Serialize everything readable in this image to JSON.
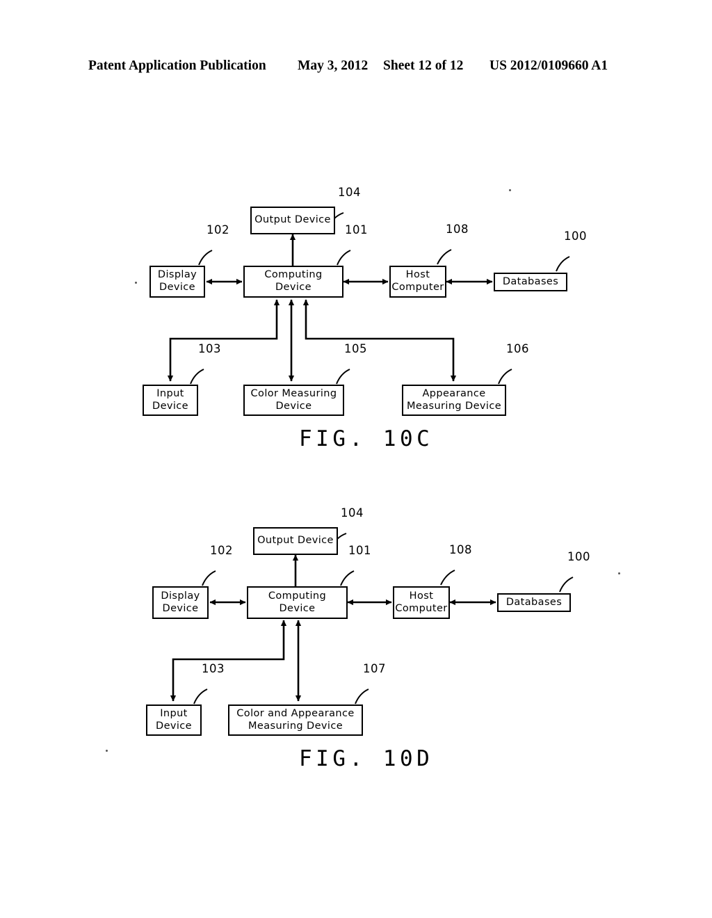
{
  "header": {
    "publication": "Patent Application Publication",
    "date": "May 3, 2012",
    "sheet": "Sheet 12 of 12",
    "document_number": "US 2012/0109660 A1"
  },
  "figures": [
    {
      "id": "fig-10c",
      "caption": "FIG. 10C",
      "nodes": [
        {
          "key": "output_device",
          "label": "Output Device",
          "ref": "104"
        },
        {
          "key": "display_device",
          "label": "Display\nDevice",
          "ref": "102"
        },
        {
          "key": "computing_device",
          "label": "Computing\nDevice",
          "ref": "101"
        },
        {
          "key": "host_computer",
          "label": "Host\nComputer",
          "ref": "108"
        },
        {
          "key": "databases",
          "label": "Databases",
          "ref": "100"
        },
        {
          "key": "input_device",
          "label": "Input\nDevice",
          "ref": "103"
        },
        {
          "key": "color_measuring",
          "label": "Color Measuring\nDevice",
          "ref": "105"
        },
        {
          "key": "appearance_measuring",
          "label": "Appearance\nMeasuring Device",
          "ref": "106"
        }
      ],
      "connections": [
        {
          "from": "computing_device",
          "to": "output_device",
          "arrows": "single"
        },
        {
          "from": "display_device",
          "to": "computing_device",
          "arrows": "double"
        },
        {
          "from": "computing_device",
          "to": "host_computer",
          "arrows": "double"
        },
        {
          "from": "host_computer",
          "to": "databases",
          "arrows": "double"
        },
        {
          "from": "computing_device",
          "to": "input_device",
          "arrows": "double"
        },
        {
          "from": "computing_device",
          "to": "color_measuring",
          "arrows": "double"
        },
        {
          "from": "computing_device",
          "to": "appearance_measuring",
          "arrows": "double"
        }
      ]
    },
    {
      "id": "fig-10d",
      "caption": "FIG. 10D",
      "nodes": [
        {
          "key": "output_device",
          "label": "Output Device",
          "ref": "104"
        },
        {
          "key": "display_device",
          "label": "Display\nDevice",
          "ref": "102"
        },
        {
          "key": "computing_device",
          "label": "Computing\nDevice",
          "ref": "101"
        },
        {
          "key": "host_computer",
          "label": "Host\nComputer",
          "ref": "108"
        },
        {
          "key": "databases",
          "label": "Databases",
          "ref": "100"
        },
        {
          "key": "input_device",
          "label": "Input\nDevice",
          "ref": "103"
        },
        {
          "key": "color_appearance_measuring",
          "label": "Color and Appearance\nMeasuring Device",
          "ref": "107"
        }
      ],
      "connections": [
        {
          "from": "computing_device",
          "to": "output_device",
          "arrows": "single"
        },
        {
          "from": "display_device",
          "to": "computing_device",
          "arrows": "double"
        },
        {
          "from": "computing_device",
          "to": "host_computer",
          "arrows": "double"
        },
        {
          "from": "host_computer",
          "to": "databases",
          "arrows": "double"
        },
        {
          "from": "computing_device",
          "to": "input_device",
          "arrows": "double"
        },
        {
          "from": "computing_device",
          "to": "color_appearance_measuring",
          "arrows": "double"
        }
      ]
    }
  ],
  "colors": {
    "ink": "#000000",
    "page": "#ffffff"
  }
}
